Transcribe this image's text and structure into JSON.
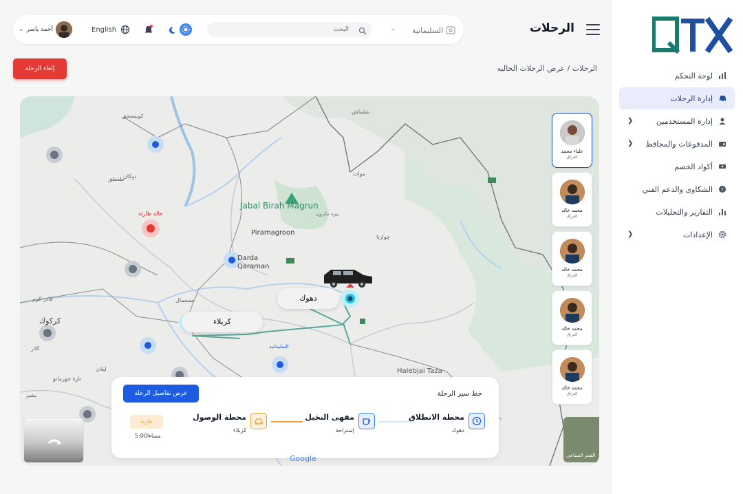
{
  "app": {
    "logo_text": "QTX",
    "brand_color": "#1f4fa3",
    "accent_color": "#1a7a6e"
  },
  "sidebar": {
    "items": [
      {
        "label": "لوحة التحكم",
        "icon": "dashboard-icon",
        "active": false,
        "has_children": false
      },
      {
        "label": "إدارة الرحلات",
        "icon": "car-icon",
        "active": true,
        "has_children": false
      },
      {
        "label": "إدارة المستخدمين",
        "icon": "user-icon",
        "active": false,
        "has_children": true
      },
      {
        "label": "المدفوعات والمحافظ",
        "icon": "wallet-icon",
        "active": false,
        "has_children": true
      },
      {
        "label": "أكواد الخصم",
        "icon": "ticket-icon",
        "active": false,
        "has_children": false
      },
      {
        "label": "الشكاوى والدعم الفني",
        "icon": "support-icon",
        "active": false,
        "has_children": false
      },
      {
        "label": "التقارير والتحليلات",
        "icon": "chart-icon",
        "active": false,
        "has_children": false
      },
      {
        "label": "الإعدادات",
        "icon": "settings-icon",
        "active": false,
        "has_children": true
      }
    ]
  },
  "header": {
    "title": "الرحلات",
    "region": "السليمانية",
    "search_placeholder": "البحث",
    "language": "English",
    "user_name": "أحمد ياسر"
  },
  "breadcrumb": "الرحلات / عرض الرحلات الحاليه",
  "actions": {
    "cancel_trip": "إلغاء الرحلة"
  },
  "map": {
    "labels": [
      "Jabal Birah Magrun",
      "Piramagroon",
      "Darda Qaraman",
      "دهوك",
      "كربلاء",
      "كركوك",
      "السليمانية",
      "Halebjai Taza",
      "حالة طارئة",
      "شلماش",
      "موات",
      "چوارتا",
      "جمجمال",
      "دوكان",
      "كويسنجق",
      "طقطق",
      "بيره مكرون",
      "كلار",
      "بشير",
      "قادر كرم",
      "ليلان",
      "تازة خورماتو"
    ],
    "route_labels": {
      "origin": "دهوك",
      "destination": "كربلاء"
    },
    "emergency_label": "حالة طارئة",
    "google_label": "Google",
    "satellite_label": "القمر الصناعي"
  },
  "drivers": [
    {
      "name": "علياء محمد",
      "region": "العراق",
      "selected": true
    },
    {
      "name": "محمد خالد",
      "region": "العراق",
      "selected": false
    },
    {
      "name": "محمد خالد",
      "region": "العراق",
      "selected": false
    },
    {
      "name": "محمد خالد",
      "region": "العراق",
      "selected": false
    },
    {
      "name": "محمد خالد",
      "region": "العراق",
      "selected": false
    }
  ],
  "trip": {
    "title": "خط سير الرحلة",
    "details_button": "عرض تفاصيل الرحلة",
    "stops": [
      {
        "title": "محطة الانطلاق",
        "subtitle": "دهوك",
        "icon": "clock-icon",
        "color": "#3b82f6"
      },
      {
        "title": "مقهى النخيل",
        "subtitle": "إستراحة",
        "icon": "coffee-icon",
        "color": "#3b82f6"
      },
      {
        "title": "محطة الوصول",
        "subtitle": "كربلاء",
        "icon": "taxi-icon",
        "color": "#f0a030"
      }
    ],
    "status": "جارية",
    "time": "5:00مساءا"
  }
}
